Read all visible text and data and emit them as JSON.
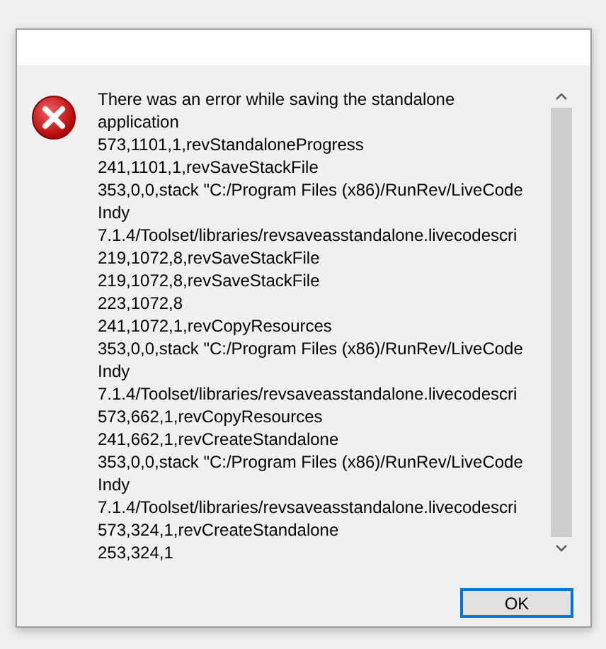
{
  "dialog": {
    "message_lines": [
      "There was an error while saving the standalone",
      "application",
      "573,1101,1,revStandaloneProgress",
      "241,1101,1,revSaveStackFile",
      "353,0,0,stack \"C:/Program Files (x86)/RunRev/LiveCode",
      "Indy",
      "7.1.4/Toolset/libraries/revsaveasstandalone.livecodescri",
      "219,1072,8,revSaveStackFile",
      "219,1072,8,revSaveStackFile",
      "223,1072,8",
      "241,1072,1,revCopyResources",
      "353,0,0,stack \"C:/Program Files (x86)/RunRev/LiveCode",
      "Indy",
      "7.1.4/Toolset/libraries/revsaveasstandalone.livecodescri",
      "573,662,1,revCopyResources",
      "241,662,1,revCreateStandalone",
      "353,0,0,stack \"C:/Program Files (x86)/RunRev/LiveCode",
      "Indy",
      "7.1.4/Toolset/libraries/revsaveasstandalone.livecodescri",
      "573,324,1,revCreateStandalone",
      "253,324,1"
    ],
    "buttons": [
      {
        "label": "OK",
        "default": true
      }
    ]
  }
}
